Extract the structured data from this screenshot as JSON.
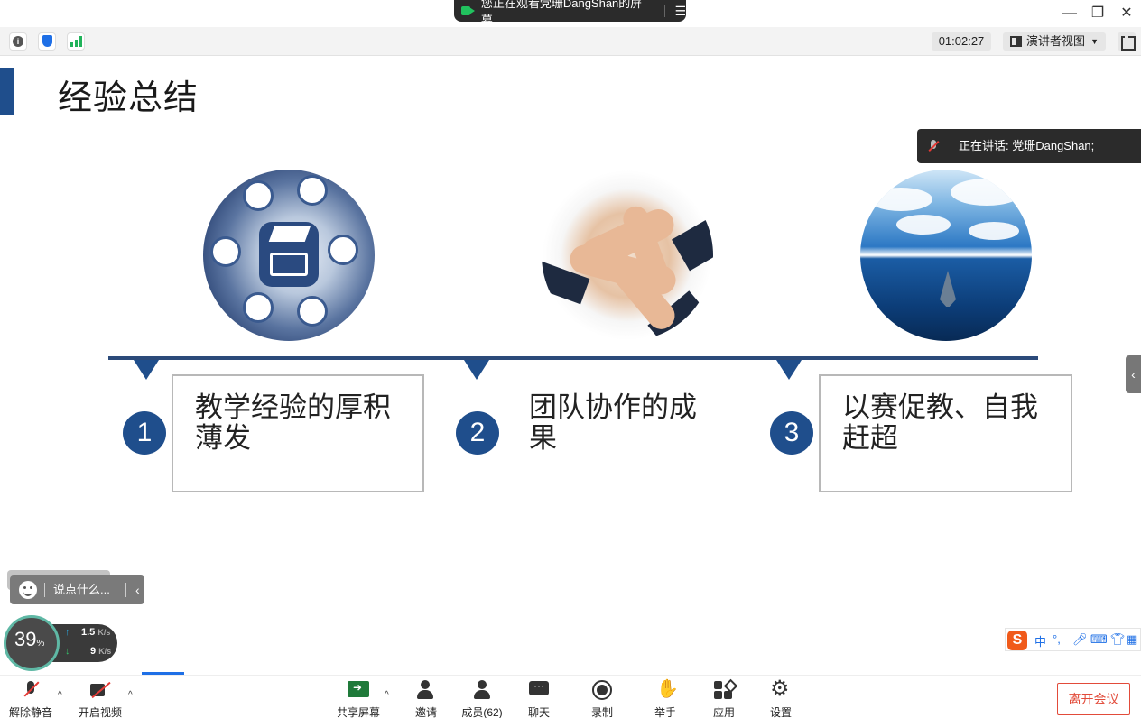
{
  "window": {
    "share_banner": "您正在观看党珊DangShan的屏幕",
    "minimize_glyph": "—",
    "restore_glyph": "❐",
    "close_glyph": "✕"
  },
  "toolbar": {
    "info_glyph": "i",
    "timer": "01:02:27",
    "view_mode": "演讲者视图",
    "view_caret": "▼"
  },
  "slide": {
    "title": "经验总结",
    "items": [
      {
        "number": "1",
        "text": "教学经验的厚积薄发"
      },
      {
        "number": "2",
        "text": "团队协作的成果"
      },
      {
        "number": "3",
        "text": "以赛促教、自我赶超"
      }
    ]
  },
  "speaking": {
    "label": "正在讲话: 党珊DangShan;"
  },
  "chat": {
    "placeholder": "说点什么...",
    "collapse_glyph": "‹"
  },
  "side_tab": {
    "glyph": "‹"
  },
  "performance": {
    "cpu_percent": "39",
    "cpu_unit": "%",
    "upload": "1.5",
    "upload_unit": "K/s",
    "download": "9",
    "download_unit": "K/s"
  },
  "ime": {
    "logo": "S",
    "lang": "中",
    "punct": "°,"
  },
  "bottom": {
    "unmute": "解除静音",
    "start_video": "开启视频",
    "share_screen": "共享屏幕",
    "invite": "邀请",
    "members": "成员(62)",
    "chat": "聊天",
    "record": "录制",
    "raise_hand": "举手",
    "apps": "应用",
    "settings": "设置",
    "leave": "离开会议",
    "caret_glyph": "^"
  },
  "colors": {
    "accent": "#1f4e8c",
    "leave": "#e24b3a",
    "ring": "#5fb8a5"
  }
}
